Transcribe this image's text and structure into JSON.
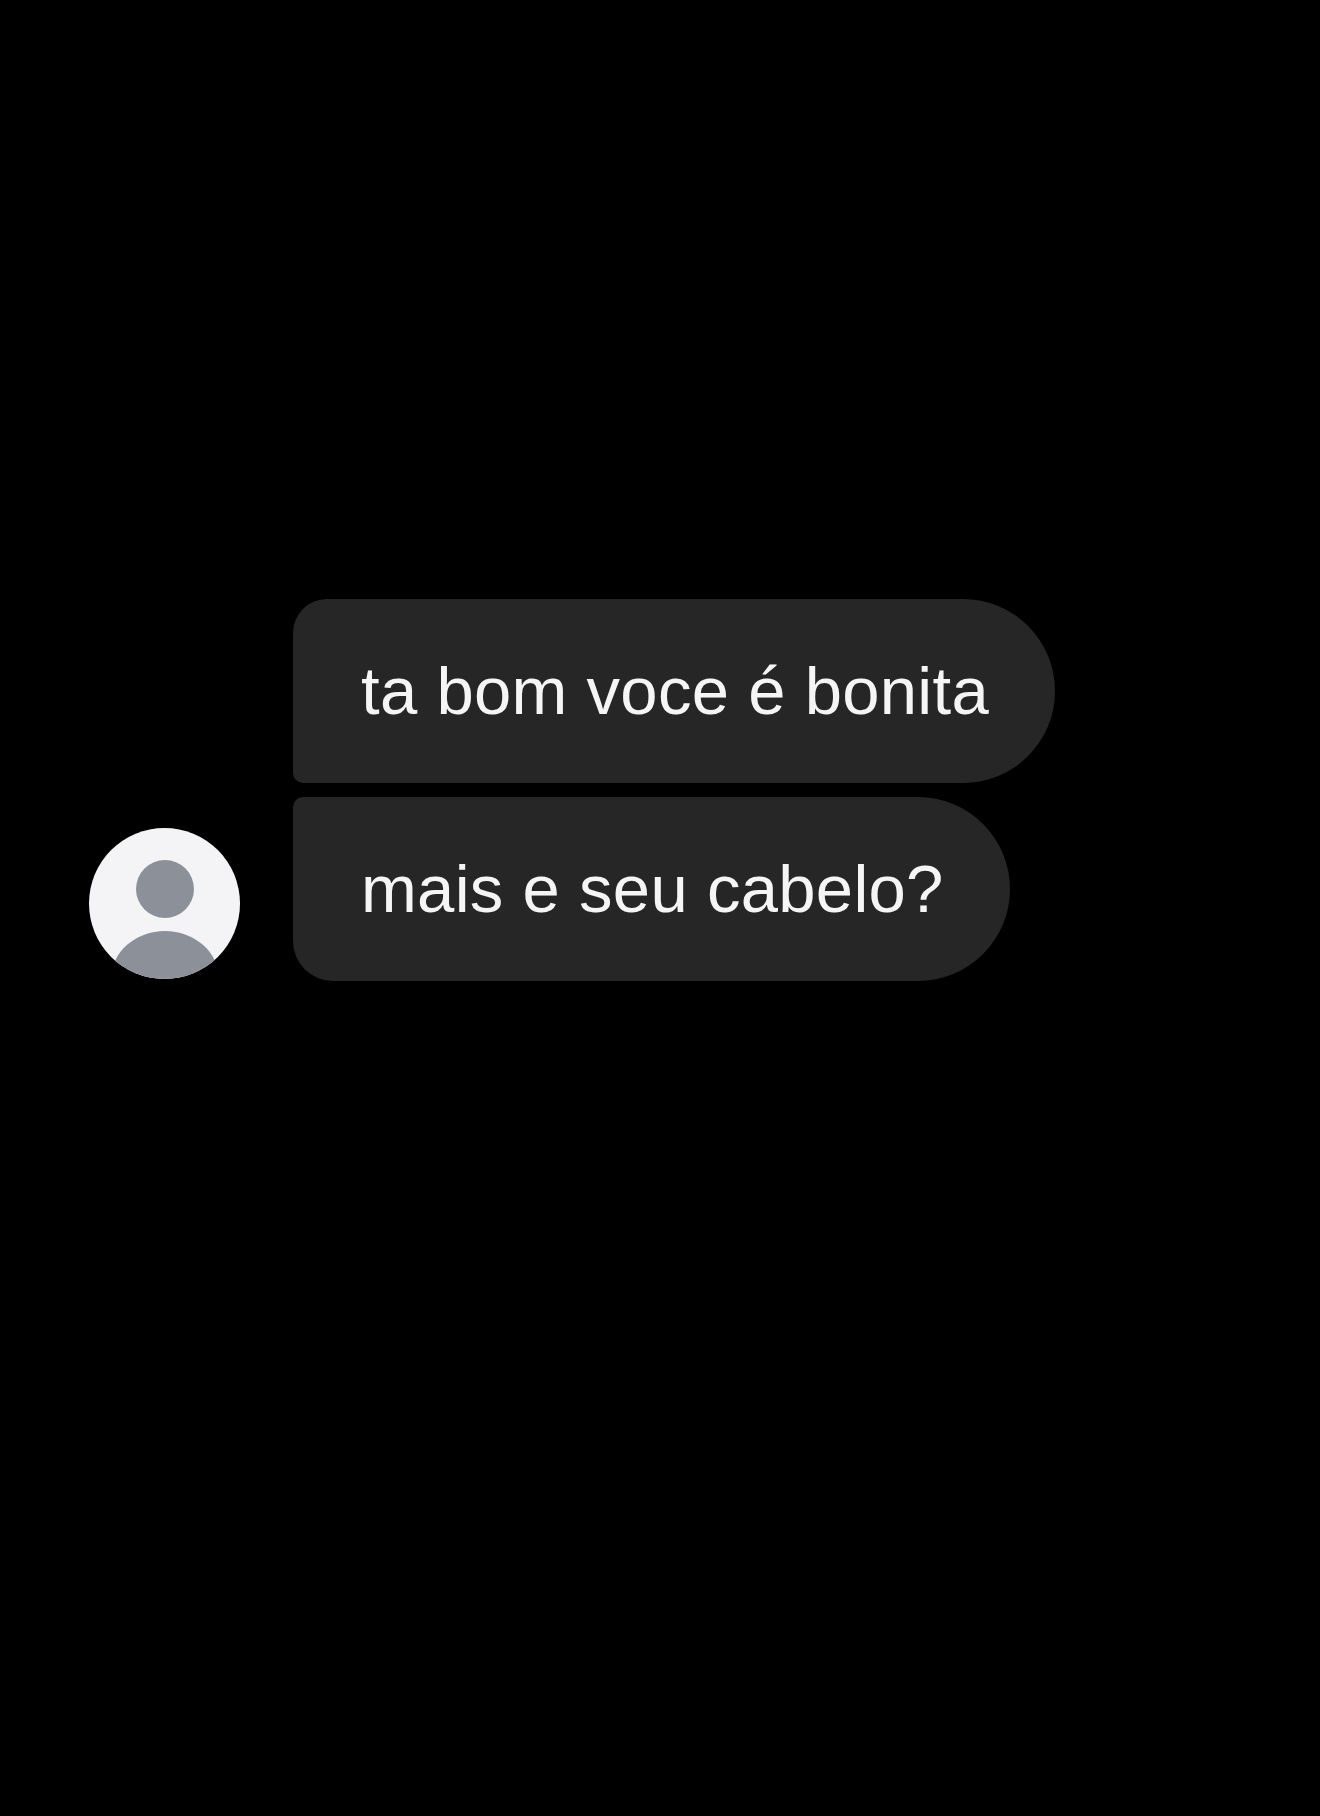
{
  "conversation": {
    "messages": [
      {
        "text": "ta bom voce é bonita"
      },
      {
        "text": "mais e seu cabelo?"
      }
    ]
  }
}
